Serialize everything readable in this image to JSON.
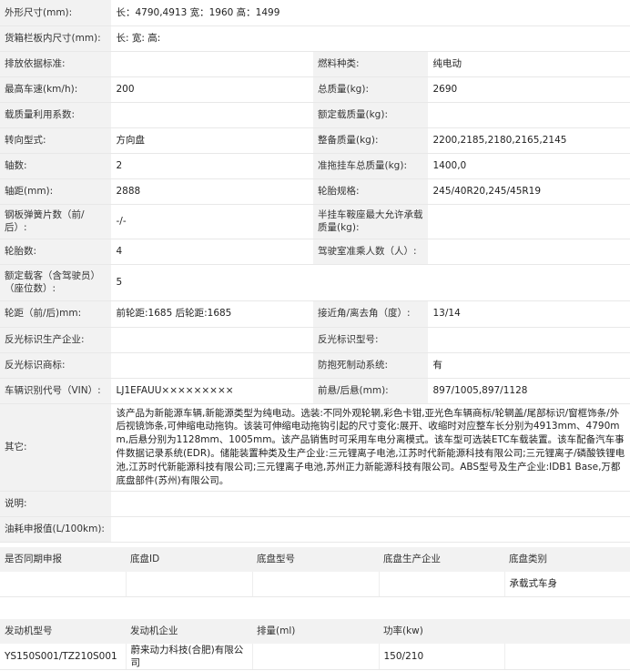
{
  "spec": [
    {
      "h": 28,
      "cells": [
        [
          "外形尺寸(mm):",
          "长：4790,4913 宽：1960 高：1499",
          3
        ]
      ]
    },
    {
      "h": 28,
      "cells": [
        [
          "货箱栏板内尺寸(mm):",
          "长:  宽:  高:",
          3
        ]
      ]
    },
    {
      "h": 28,
      "cells": [
        [
          "排放依据标准:",
          ""
        ],
        [
          "燃料种类:",
          "纯电动"
        ]
      ]
    },
    {
      "h": 28,
      "cells": [
        [
          "最高车速(km/h):",
          "200"
        ],
        [
          "总质量(kg):",
          "2690"
        ]
      ]
    },
    {
      "h": 28,
      "cells": [
        [
          "载质量利用系数:",
          ""
        ],
        [
          "额定载质量(kg):",
          ""
        ]
      ]
    },
    {
      "h": 28,
      "cells": [
        [
          "转向型式:",
          "方向盘"
        ],
        [
          "整备质量(kg):",
          "2200,2185,2180,2165,2145"
        ]
      ]
    },
    {
      "h": 28,
      "cells": [
        [
          "轴数:",
          "2"
        ],
        [
          "准拖挂车总质量(kg):",
          "1400,0"
        ]
      ]
    },
    {
      "h": 28,
      "cells": [
        [
          "轴距(mm):",
          "2888"
        ],
        [
          "轮胎规格:",
          "245/40R20,245/45R19"
        ]
      ]
    },
    {
      "h": 38,
      "cells": [
        [
          "钢板弹簧片数（前/后）:",
          "-/-"
        ],
        [
          "半挂车鞍座最大允许承载质量(kg):",
          ""
        ]
      ]
    },
    {
      "h": 28,
      "cells": [
        [
          "轮胎数:",
          "4"
        ],
        [
          "驾驶室准乘人数（人）:",
          ""
        ]
      ]
    },
    {
      "h": 40,
      "cells": [
        [
          "额定载客（含驾驶员）（座位数）:",
          "5",
          3
        ]
      ]
    },
    {
      "h": 29,
      "cells": [
        [
          "轮距（前/后)mm:",
          "前轮距:1685 后轮距:1685"
        ],
        [
          "接近角/离去角（度）:",
          "13/14"
        ]
      ]
    },
    {
      "h": 28,
      "cells": [
        [
          "反光标识生产企业:",
          ""
        ],
        [
          "反光标识型号:",
          ""
        ]
      ]
    },
    {
      "h": 28,
      "cells": [
        [
          "反光标识商标:",
          ""
        ],
        [
          "防抱死制动系统:",
          "有"
        ]
      ]
    },
    {
      "h": 28,
      "cells": [
        [
          "车辆识别代号（VIN）:",
          "LJ1EFAUU×××××××××"
        ],
        [
          "前悬/后悬(mm):",
          "897/1005,897/1128"
        ]
      ]
    },
    {
      "h": 86,
      "cells": [
        [
          "其它:",
          "该产品为新能源车辆,新能源类型为纯电动。选装:不同外观轮辋,彩色卡钳,亚光色车辆商标/轮辋盖/尾部标识/窗框饰条/外后视镜饰条,可伸缩电动拖钩。该装可伸缩电动拖钩引起的尺寸变化:展开、收缩时对应整车长分别为4913mm、4790mm,后悬分别为1128mm、1005mm。该产品销售时可采用车电分离模式。该车型可选装ETC车载装置。该车配备汽车事件数据记录系统(EDR)。储能装置种类及生产企业:三元锂离子电池,江苏时代新能源科技有限公司;三元锂离子/磷酸铁锂电池,江苏时代新能源科技有限公司;三元锂离子电池,苏州正力新能源科技有限公司。ABS型号及生产企业:IDB1 Base,万都底盘部件(苏州)有限公司。",
          3
        ]
      ]
    },
    {
      "h": 28,
      "cells": [
        [
          "说明:",
          "",
          3
        ]
      ]
    },
    {
      "h": 28,
      "cells": [
        [
          "油耗申报值(L/100km):",
          "",
          3
        ]
      ]
    }
  ],
  "chassis": {
    "headers": [
      "是否同期申报",
      "底盘ID",
      "底盘型号",
      "底盘生产企业",
      "底盘类别"
    ],
    "rows": [
      [
        "",
        "",
        "",
        "",
        "承载式车身"
      ]
    ]
  },
  "engine": {
    "headers": [
      "发动机型号",
      "发动机企业",
      "排量(ml)",
      "功率(kw)",
      ""
    ],
    "rows": [
      [
        "YS150S001/TZ210S001",
        "蔚来动力科技(合肥)有限公司",
        "",
        "150/210",
        ""
      ]
    ]
  }
}
